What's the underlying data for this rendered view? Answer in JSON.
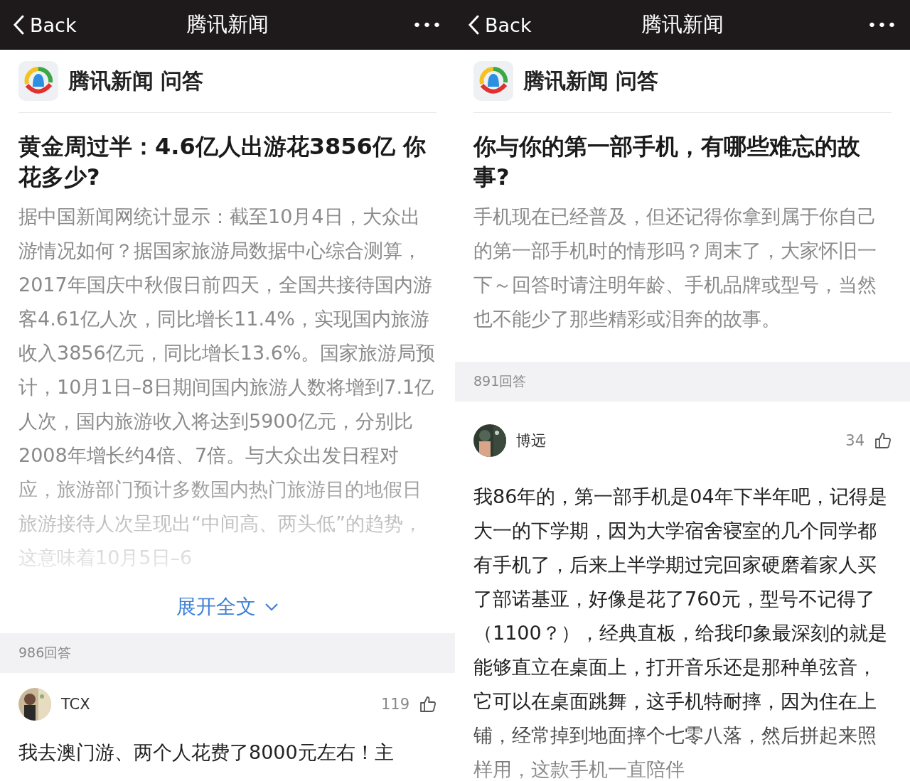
{
  "panels": [
    {
      "nav": {
        "back": "Back",
        "title": "腾讯新闻",
        "more": "•••"
      },
      "source": {
        "name": "腾讯新闻 问答"
      },
      "question": {
        "title": "黄金周过半：4.6亿人出游花3856亿 你花多少?",
        "body": "据中国新闻网统计显示：截至10月4日，大众出游情况如何？据国家旅游局数据中心综合测算，2017年国庆中秋假日前四天，全国共接待国内游客4.61亿人次，同比增长11.4%，实现国内旅游收入3856亿元，同比增长13.6%。国家旅游局预计，10月1日–8日期间国内旅游人数将增到7.1亿人次，国内旅游收入将达到5900亿元，分别比2008年增长约4倍、7倍。与大众出发日程对应，旅游部门预计多数国内热门旅游目的地假日旅游接待人次呈现出“中间高、两头低”的趋势，这意味着10月5日–6",
        "faded": true
      },
      "expand": {
        "label": "展开全文"
      },
      "answer_count": "986回答",
      "answer": {
        "author": "TCX",
        "likes": "119",
        "text": "我去澳门游、两个人花费了8000元左右！主"
      }
    },
    {
      "nav": {
        "back": "Back",
        "title": "腾讯新闻",
        "more": "•••"
      },
      "source": {
        "name": "腾讯新闻 问答"
      },
      "question": {
        "title": "你与你的第一部手机，有哪些难忘的故事?",
        "body": "手机现在已经普及，但还记得你拿到属于你自己的第一部手机时的情形吗？周末了，大家怀旧一下～回答时请注明年龄、手机品牌或型号，当然也不能少了那些精彩或泪奔的故事。",
        "faded": false
      },
      "answer_count": "891回答",
      "answer": {
        "author": "博远",
        "likes": "34",
        "text": "我86年的，第一部手机是04年下半年吧，记得是大一的下学期，因为大学宿舍寝室的几个同学都有手机了，后来上半学期过完回家硬磨着家人买了部诺基亚，好像是花了760元，型号不记得了（1100？），经典直板，给我印象最深刻的就是能够直立在桌面上，打开音乐还是那种单弦音，它可以在桌面跳舞，这手机特耐摔，因为住在上铺，经常掉到地面摔个七零八落，然后拼起来照样用，这款手机一直陪伴",
        "faded": true
      }
    }
  ]
}
